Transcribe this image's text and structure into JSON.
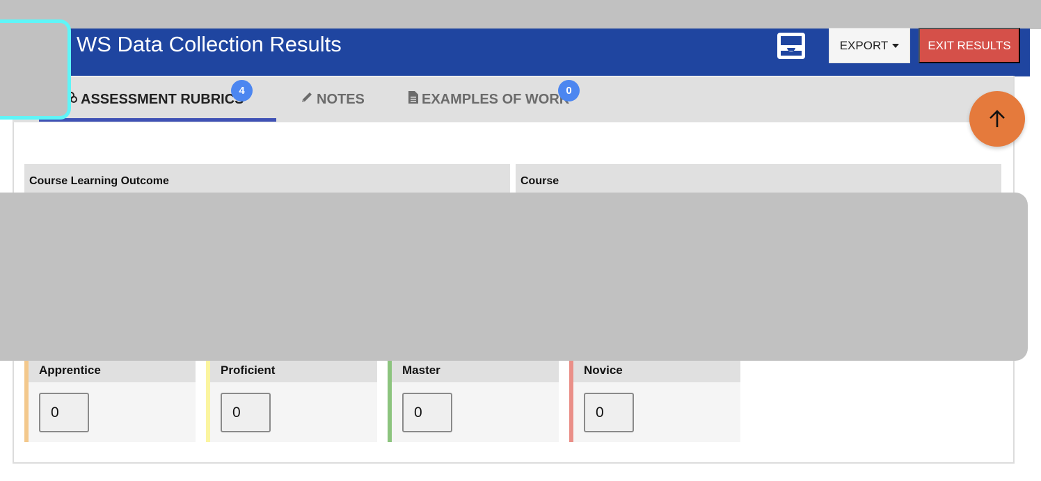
{
  "header": {
    "title": "WS Data Collection Results",
    "export_label": "EXPORT",
    "exit_label": "EXIT RESULTS",
    "color": "#1f45a0"
  },
  "tabs": [
    {
      "label": "ASSESSMENT RUBRICS",
      "badge": "4",
      "icon": "rubric-icon",
      "active": true
    },
    {
      "label": "NOTES",
      "icon": "pencil-icon",
      "active": false
    },
    {
      "label": "EXAMPLES OF WORK",
      "badge": "0",
      "icon": "document-icon",
      "active": false
    }
  ],
  "columns": {
    "outcome": "Course Learning Outcome",
    "course": "Course"
  },
  "levels": [
    {
      "name": "Apprentice",
      "value": "0",
      "color": "#f3c88c"
    },
    {
      "name": "Proficient",
      "value": "0",
      "color": "#fbf5a0"
    },
    {
      "name": "Master",
      "value": "0",
      "color": "#8cc47e"
    },
    {
      "name": "Novice",
      "value": "0",
      "color": "#ea8f88"
    }
  ]
}
